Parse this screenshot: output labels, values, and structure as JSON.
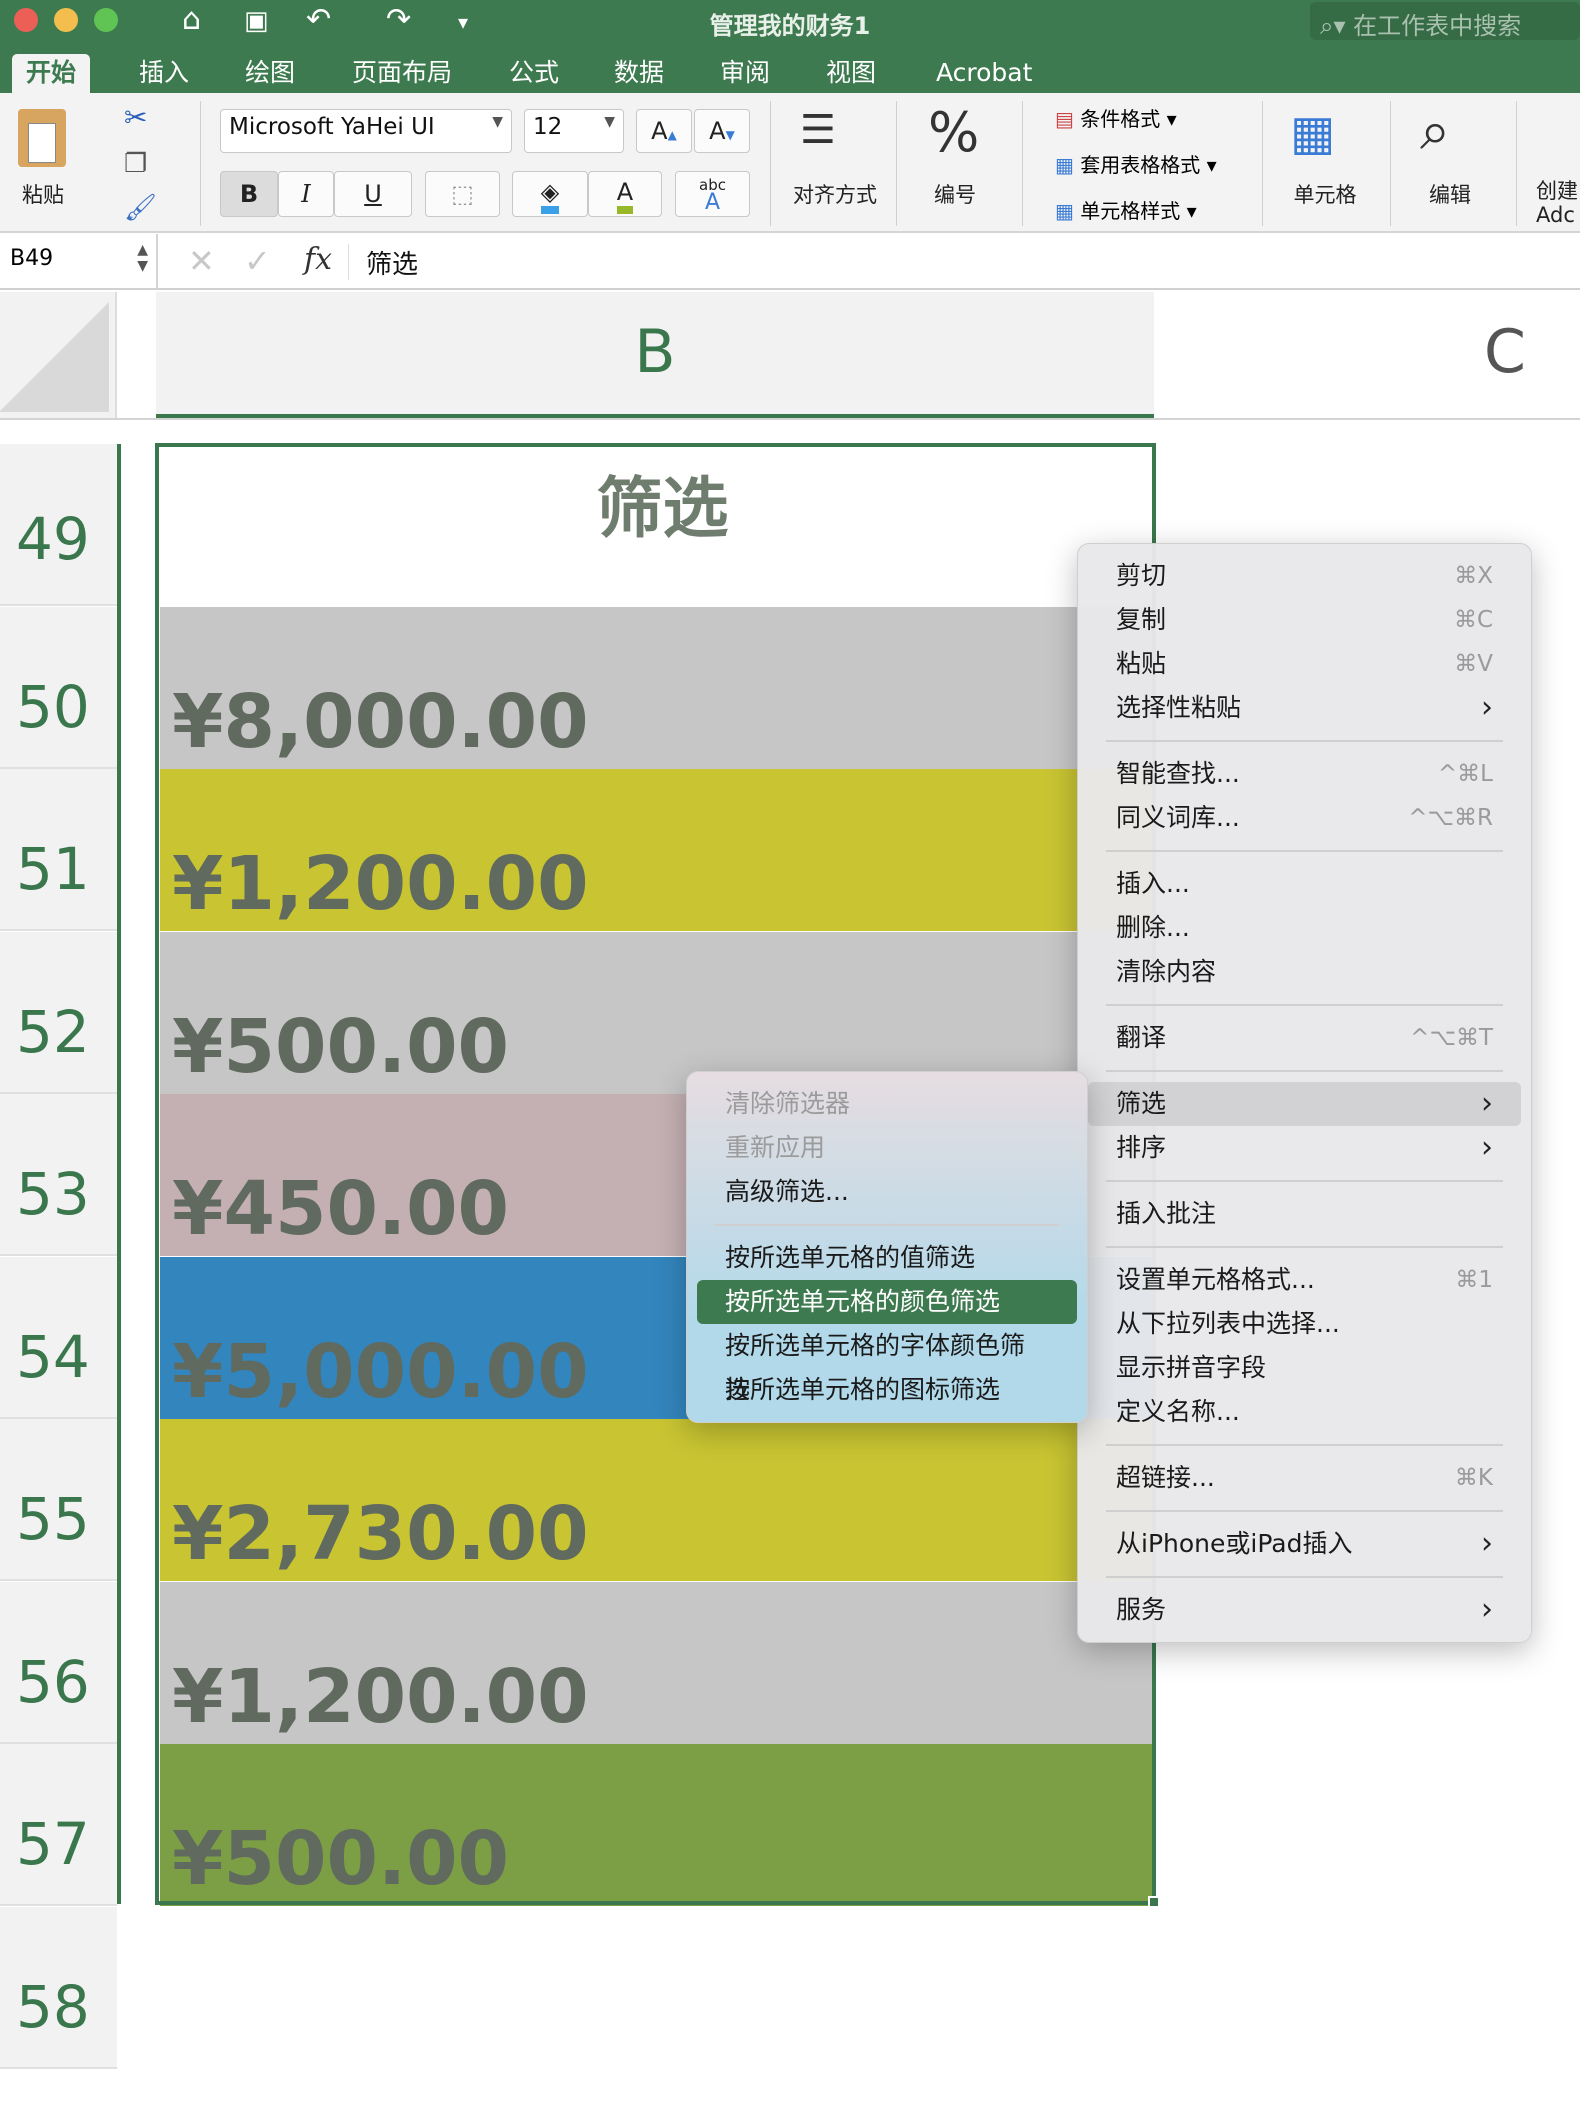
{
  "window": {
    "title": "管理我的财务1",
    "search_placeholder": "在工作表中搜索"
  },
  "ribbon_tabs": [
    "开始",
    "插入",
    "绘图",
    "页面布局",
    "公式",
    "数据",
    "审阅",
    "视图",
    "Acrobat"
  ],
  "ribbon": {
    "paste": "粘贴",
    "font_name": "Microsoft YaHei UI",
    "font_size": "12",
    "bold": "B",
    "italic": "I",
    "underline": "U",
    "grow": "A",
    "shrink": "A",
    "font_color": "A",
    "abc": "abc",
    "alignment": "对齐方式",
    "number": "编号",
    "conditional_format": "条件格式",
    "table_format": "套用表格格式",
    "cell_styles": "单元格样式",
    "cells": "单元格",
    "edit": "编辑",
    "create": "创建",
    "adobe": "Adc"
  },
  "formula_bar": {
    "name_box": "B49",
    "fx": "fx",
    "content": "筛选"
  },
  "columns": [
    "B",
    "C"
  ],
  "rows": [
    {
      "num": "49",
      "value": "筛选",
      "fill": "#ffffff"
    },
    {
      "num": "50",
      "value": "¥8,000.00",
      "fill": "#c6c6c6"
    },
    {
      "num": "51",
      "value": "¥1,200.00",
      "fill": "#c8c432"
    },
    {
      "num": "52",
      "value": "¥500.00",
      "fill": "#c6c6c6"
    },
    {
      "num": "53",
      "value": "¥450.00",
      "fill": "#c4b0b3"
    },
    {
      "num": "54",
      "value": "¥5,000.00",
      "fill": "#3385bd"
    },
    {
      "num": "55",
      "value": "¥2,730.00",
      "fill": "#c8c432"
    },
    {
      "num": "56",
      "value": "¥1,200.00",
      "fill": "#c6c6c6"
    },
    {
      "num": "57",
      "value": "¥500.00",
      "fill": "#7c9f46"
    },
    {
      "num": "58",
      "value": "",
      "fill": "#ffffff"
    }
  ],
  "context_menu": [
    {
      "label": "剪切",
      "shortcut": "⌘X"
    },
    {
      "label": "复制",
      "shortcut": "⌘C"
    },
    {
      "label": "粘贴",
      "shortcut": "⌘V"
    },
    {
      "label": "选择性粘贴",
      "shortcut": "›"
    },
    {
      "sep": true
    },
    {
      "label": "智能查找...",
      "shortcut": "^⌘L"
    },
    {
      "label": "同义词库...",
      "shortcut": "^⌥⌘R"
    },
    {
      "sep": true
    },
    {
      "label": "插入...",
      "shortcut": ""
    },
    {
      "label": "删除...",
      "shortcut": ""
    },
    {
      "label": "清除内容",
      "shortcut": ""
    },
    {
      "sep": true
    },
    {
      "label": "翻译",
      "shortcut": "^⌥⌘T"
    },
    {
      "sep": true
    },
    {
      "label": "筛选",
      "shortcut": "›",
      "state": "hover"
    },
    {
      "label": "排序",
      "shortcut": "›"
    },
    {
      "sep": true
    },
    {
      "label": "插入批注",
      "shortcut": ""
    },
    {
      "sep": true
    },
    {
      "label": "设置单元格格式...",
      "shortcut": "⌘1"
    },
    {
      "label": "从下拉列表中选择...",
      "shortcut": ""
    },
    {
      "label": "显示拼音字段",
      "shortcut": ""
    },
    {
      "label": "定义名称...",
      "shortcut": ""
    },
    {
      "sep": true
    },
    {
      "label": "超链接...",
      "shortcut": "⌘K"
    },
    {
      "sep": true
    },
    {
      "label": "从iPhone或iPad插入",
      "shortcut": "›"
    },
    {
      "sep": true
    },
    {
      "label": "服务",
      "shortcut": "›"
    }
  ],
  "filter_submenu": [
    {
      "label": "清除筛选器",
      "state": "disabled"
    },
    {
      "label": "重新应用",
      "state": "disabled"
    },
    {
      "label": "高级筛选..."
    },
    {
      "sep": true
    },
    {
      "label": "按所选单元格的值筛选"
    },
    {
      "label": "按所选单元格的颜色筛选",
      "state": "selected"
    },
    {
      "label": "按所选单元格的字体颜色筛选"
    },
    {
      "label": "按所选单元格的图标筛选"
    }
  ],
  "colors": {
    "accent": "#3e7a4f",
    "selection_border": "#3a774c"
  }
}
